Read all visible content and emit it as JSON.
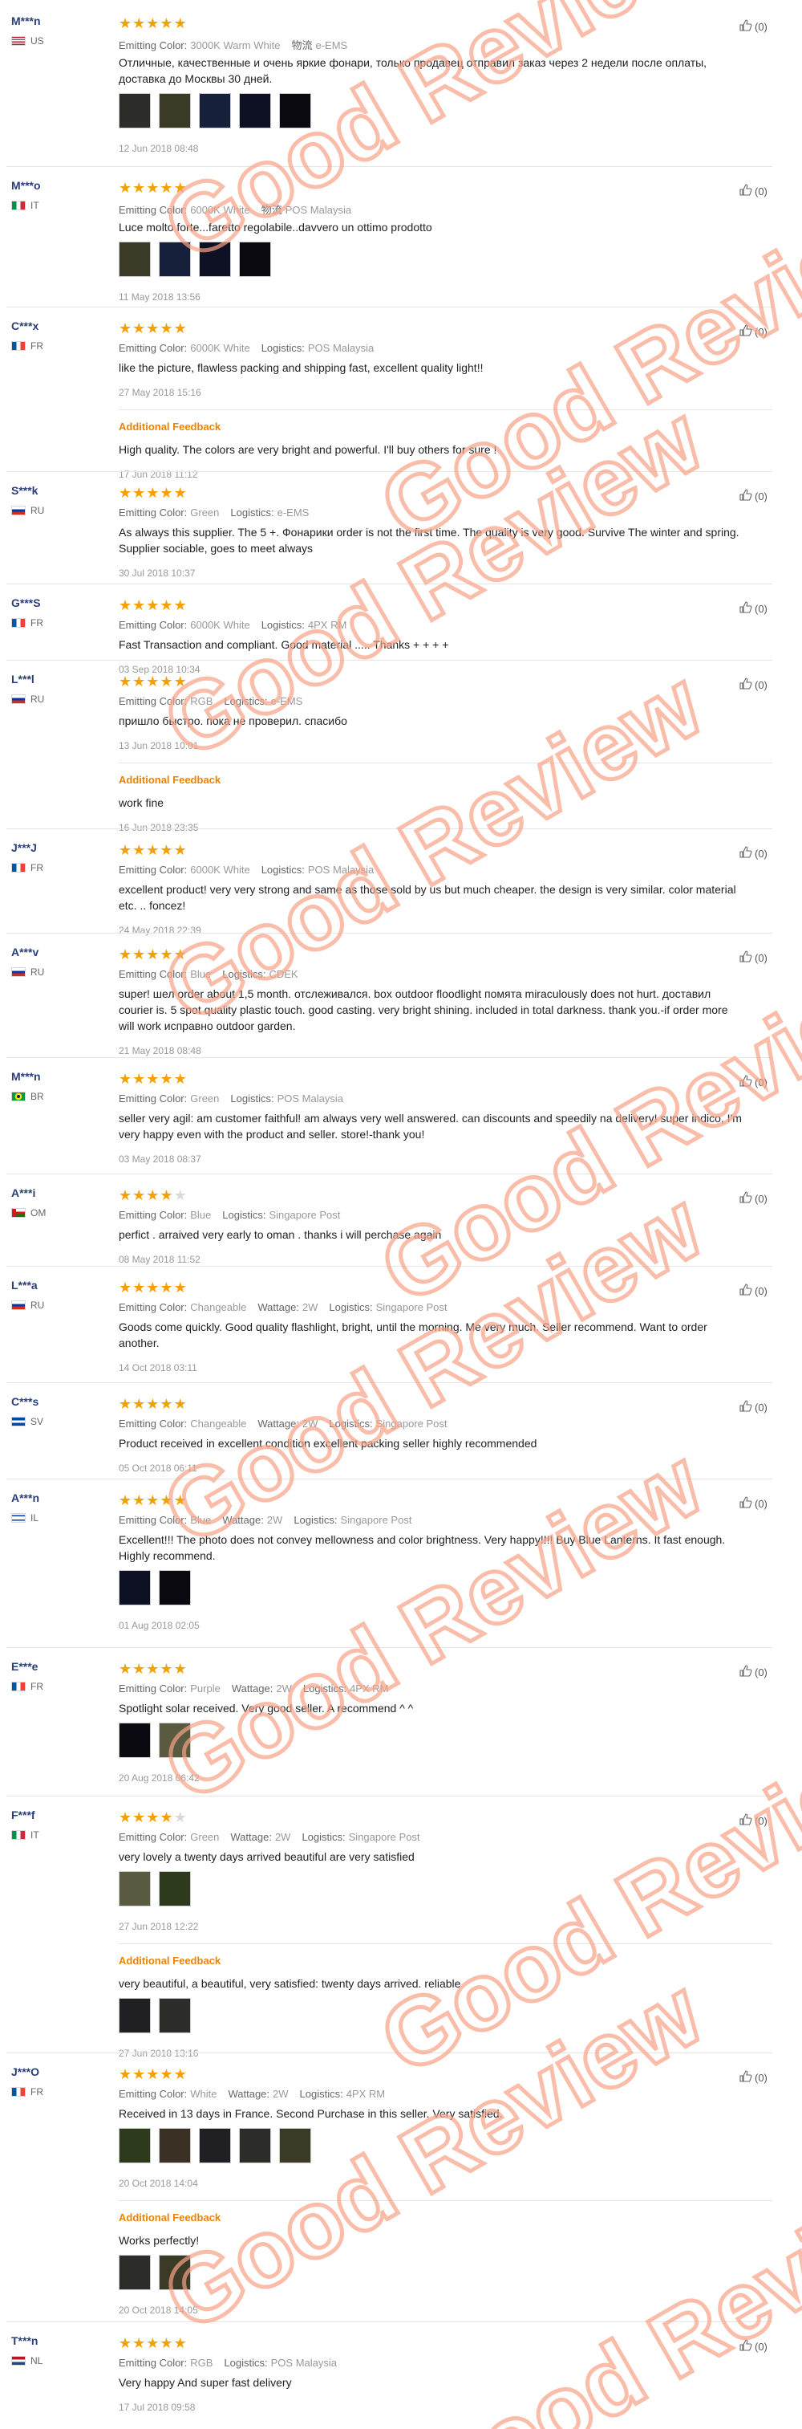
{
  "watermark_text": "Good Review",
  "colors": {
    "username": "#2a3f7a",
    "star": "#f4a000",
    "additional_feedback": "#f08200",
    "watermark": "#f7a286"
  },
  "like_icon": "thumbs-up-icon",
  "reviews": [
    {
      "user": "M***n",
      "country": "US",
      "flag": "flag-us",
      "stars": 5,
      "likes": "(0)",
      "attrs": [
        {
          "label": "Emitting Color:",
          "value": "3000K Warm White"
        },
        {
          "label": "物流",
          "value": "e-EMS"
        }
      ],
      "text": [
        "Отличные, качественные и очень яркие фонари, только продавец отправил заказ через 2 недели после оплаты,",
        "доставка до Москвы 30 дней."
      ],
      "photos": 5,
      "date": "12 Jun 2018 08:48",
      "additional": null
    },
    {
      "user": "M***o",
      "country": "IT",
      "flag": "flag-it",
      "stars": 5,
      "likes": "(0)",
      "attrs": [
        {
          "label": "Emitting Color:",
          "value": "6000K White"
        },
        {
          "label": "物流",
          "value": "POS Malaysia"
        }
      ],
      "text": [
        "Luce molto forte...faretto regolabile..davvero un ottimo prodotto"
      ],
      "photos": 4,
      "date": "11 May 2018 13:56",
      "additional": null
    },
    {
      "user": "C***x",
      "country": "FR",
      "flag": "flag-fr",
      "stars": 5,
      "likes": "(0)",
      "attrs": [
        {
          "label": "Emitting Color:",
          "value": "6000K White"
        },
        {
          "label": "Logistics:",
          "value": "POS Malaysia"
        }
      ],
      "text": [
        "like the picture, flawless packing and shipping fast, excellent quality light!!"
      ],
      "photos": 0,
      "date": "27 May 2018 15:16",
      "additional": {
        "label": "Additional Feedback",
        "text": [
          "High quality. The colors are very bright and powerful. I'll buy others for sure !"
        ],
        "photos": 0,
        "date": "17 Jun 2018 11:12"
      }
    },
    {
      "user": "S***k",
      "country": "RU",
      "flag": "flag-ru",
      "stars": 5,
      "likes": "(0)",
      "attrs": [
        {
          "label": "Emitting Color:",
          "value": "Green"
        },
        {
          "label": "Logistics:",
          "value": "e-EMS"
        }
      ],
      "text": [
        "As always this supplier. The 5 +. Фонарики order is not the first time. The quality is very good. Survive The winter and spring.",
        "Supplier sociable, goes to meet always"
      ],
      "photos": 0,
      "date": "30 Jul 2018 10:37",
      "additional": null
    },
    {
      "user": "G***S",
      "country": "FR",
      "flag": "flag-fr",
      "stars": 5,
      "likes": "(0)",
      "attrs": [
        {
          "label": "Emitting Color:",
          "value": "6000K White"
        },
        {
          "label": "Logistics:",
          "value": "4PX RM"
        }
      ],
      "text": [
        "Fast Transaction and compliant. Good material ..... Thanks + + + +"
      ],
      "photos": 0,
      "date": "03 Sep 2018 10:34",
      "additional": null
    },
    {
      "user": "L***l",
      "country": "RU",
      "flag": "flag-ru",
      "stars": 5,
      "likes": "(0)",
      "attrs": [
        {
          "label": "Emitting Color:",
          "value": "RGB"
        },
        {
          "label": "Logistics:",
          "value": "e-EMS"
        }
      ],
      "text": [
        "пришло быстро. пока не проверил. спасибо"
      ],
      "photos": 0,
      "date": "13 Jun 2018 10:01",
      "additional": {
        "label": "Additional Feedback",
        "text": [
          "work fine"
        ],
        "photos": 0,
        "date": "16 Jun 2018 23:35"
      }
    },
    {
      "user": "J***J",
      "country": "FR",
      "flag": "flag-fr",
      "stars": 5,
      "likes": "(0)",
      "attrs": [
        {
          "label": "Emitting Color:",
          "value": "6000K White"
        },
        {
          "label": "Logistics:",
          "value": "POS Malaysia"
        }
      ],
      "text": [
        "excellent product! very very strong and same as those sold by us but much cheaper. the design is very similar. color material",
        "etc. .. foncez!"
      ],
      "photos": 0,
      "date": "24 May 2018 22:39",
      "additional": null
    },
    {
      "user": "A***v",
      "country": "RU",
      "flag": "flag-ru",
      "stars": 5,
      "likes": "(0)",
      "attrs": [
        {
          "label": "Emitting Color:",
          "value": "Blue"
        },
        {
          "label": "Logistics:",
          "value": "CDEK"
        }
      ],
      "text": [
        "super! шел order about 1,5 month. отслеживался. box outdoor floodlight помята miraculously does not hurt. доставил",
        "courier is. 5 spot quality plastic touch. good casting. very bright shining. included in total darkness. thank you.-if order more",
        "will work исправно outdoor garden."
      ],
      "photos": 0,
      "date": "21 May 2018 08:48",
      "additional": null
    },
    {
      "user": "M***n",
      "country": "BR",
      "flag": "flag-br",
      "stars": 5,
      "likes": "(0)",
      "attrs": [
        {
          "label": "Emitting Color:",
          "value": "Green"
        },
        {
          "label": "Logistics:",
          "value": "POS Malaysia"
        }
      ],
      "text": [
        "seller very agil: am customer faithful! am always very well answered. can discounts and speedily na delivery! super indico, I'm",
        "very happy even with the product and seller. store!-thank you!"
      ],
      "photos": 0,
      "date": "03 May 2018 08:37",
      "additional": null
    },
    {
      "user": "A***i",
      "country": "OM",
      "flag": "flag-om",
      "stars": 4,
      "likes": "(0)",
      "attrs": [
        {
          "label": "Emitting Color:",
          "value": "Blue"
        },
        {
          "label": "Logistics:",
          "value": "Singapore Post"
        }
      ],
      "text": [
        "perfict . arraived very early to oman . thanks i will perchase again"
      ],
      "photos": 0,
      "date": "08 May 2018 11:52",
      "additional": null
    },
    {
      "user": "L***a",
      "country": "RU",
      "flag": "flag-ru",
      "stars": 5,
      "likes": "(0)",
      "attrs": [
        {
          "label": "Emitting Color:",
          "value": "Changeable"
        },
        {
          "label": "Wattage:",
          "value": "2W"
        },
        {
          "label": "Logistics:",
          "value": "Singapore Post"
        }
      ],
      "text": [
        "Goods come quickly. Good quality flashlight, bright, until the morning. Me very much. Seller recommend. Want to order",
        "another."
      ],
      "photos": 0,
      "date": "14 Oct 2018 03:11",
      "additional": null
    },
    {
      "user": "C***s",
      "country": "SV",
      "flag": "flag-sv",
      "stars": 5,
      "likes": "(0)",
      "attrs": [
        {
          "label": "Emitting Color:",
          "value": "Changeable"
        },
        {
          "label": "Wattage:",
          "value": "2W"
        },
        {
          "label": "Logistics:",
          "value": "Singapore Post"
        }
      ],
      "text": [
        "Product received in excellent condition excellent packing seller highly recommended"
      ],
      "photos": 0,
      "date": "05 Oct 2018 06:11",
      "additional": null
    },
    {
      "user": "A***n",
      "country": "IL",
      "flag": "flag-il",
      "stars": 5,
      "likes": "(0)",
      "attrs": [
        {
          "label": "Emitting Color:",
          "value": "Blue"
        },
        {
          "label": "Wattage:",
          "value": "2W"
        },
        {
          "label": "Logistics:",
          "value": "Singapore Post"
        }
      ],
      "text": [
        "Excellent!!! The photo does not convey mellowness and color brightness. Very happy!!!! Buy Blue Lanterns. It fast enough.",
        "Highly recommend."
      ],
      "photos": 2,
      "date": "01 Aug 2018 02:05",
      "additional": null
    },
    {
      "user": "E***e",
      "country": "FR",
      "flag": "flag-fr",
      "stars": 5,
      "likes": "(0)",
      "attrs": [
        {
          "label": "Emitting Color:",
          "value": "Purple"
        },
        {
          "label": "Wattage:",
          "value": "2W"
        },
        {
          "label": "Logistics:",
          "value": "4PX RM"
        }
      ],
      "text": [
        "Spotlight solar received. Very good seller. A recommend ^ ^"
      ],
      "photos": 2,
      "date": "20 Aug 2018 06:42",
      "additional": null
    },
    {
      "user": "F***f",
      "country": "IT",
      "flag": "flag-it",
      "stars": 4,
      "likes": "(0)",
      "attrs": [
        {
          "label": "Emitting Color:",
          "value": "Green"
        },
        {
          "label": "Wattage:",
          "value": "2W"
        },
        {
          "label": "Logistics:",
          "value": "Singapore Post"
        }
      ],
      "text": [
        "very lovely a twenty days arrived beautiful are very satisfied"
      ],
      "photos": 2,
      "date": "27 Jun 2018 12:22",
      "additional": {
        "label": "Additional Feedback",
        "text": [
          "very beautiful, a beautiful, very satisfied: twenty days arrived. reliable"
        ],
        "photos": 2,
        "date": "27 Jun 2018 13:16"
      }
    },
    {
      "user": "J***O",
      "country": "FR",
      "flag": "flag-fr",
      "stars": 5,
      "likes": "(0)",
      "attrs": [
        {
          "label": "Emitting Color:",
          "value": "White"
        },
        {
          "label": "Wattage:",
          "value": "2W"
        },
        {
          "label": "Logistics:",
          "value": "4PX RM"
        }
      ],
      "text": [
        "Received in 13 days in France. Second Purchase in this seller. Very satisfied."
      ],
      "photos": 5,
      "date": "20 Oct 2018 14:04",
      "additional": {
        "label": "Additional Feedback",
        "text": [
          "Works perfectly!"
        ],
        "photos": 2,
        "date": "20 Oct 2018 14:05"
      }
    },
    {
      "user": "T***n",
      "country": "NL",
      "flag": "flag-nl",
      "stars": 5,
      "likes": "(0)",
      "attrs": [
        {
          "label": "Emitting Color:",
          "value": "RGB"
        },
        {
          "label": "Logistics:",
          "value": "POS Malaysia"
        }
      ],
      "text": [
        "Very happy And super fast delivery"
      ],
      "photos": 0,
      "date": "17 Jul 2018 09:58",
      "additional": null
    }
  ]
}
